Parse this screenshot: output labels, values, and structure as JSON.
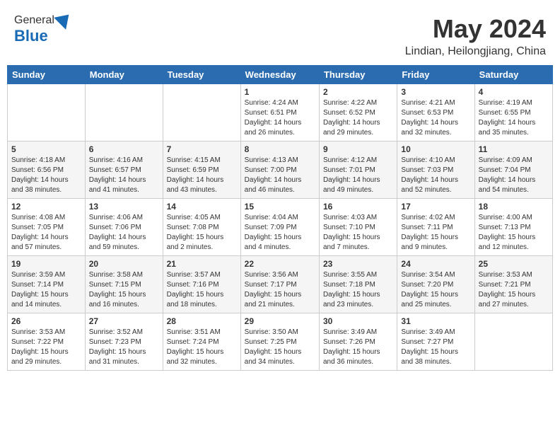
{
  "header": {
    "logo_general": "General",
    "logo_blue": "Blue",
    "month": "May 2024",
    "location": "Lindian, Heilongjiang, China"
  },
  "days_of_week": [
    "Sunday",
    "Monday",
    "Tuesday",
    "Wednesday",
    "Thursday",
    "Friday",
    "Saturday"
  ],
  "weeks": [
    [
      {
        "day": "",
        "info": ""
      },
      {
        "day": "",
        "info": ""
      },
      {
        "day": "",
        "info": ""
      },
      {
        "day": "1",
        "info": "Sunrise: 4:24 AM\nSunset: 6:51 PM\nDaylight: 14 hours\nand 26 minutes."
      },
      {
        "day": "2",
        "info": "Sunrise: 4:22 AM\nSunset: 6:52 PM\nDaylight: 14 hours\nand 29 minutes."
      },
      {
        "day": "3",
        "info": "Sunrise: 4:21 AM\nSunset: 6:53 PM\nDaylight: 14 hours\nand 32 minutes."
      },
      {
        "day": "4",
        "info": "Sunrise: 4:19 AM\nSunset: 6:55 PM\nDaylight: 14 hours\nand 35 minutes."
      }
    ],
    [
      {
        "day": "5",
        "info": "Sunrise: 4:18 AM\nSunset: 6:56 PM\nDaylight: 14 hours\nand 38 minutes."
      },
      {
        "day": "6",
        "info": "Sunrise: 4:16 AM\nSunset: 6:57 PM\nDaylight: 14 hours\nand 41 minutes."
      },
      {
        "day": "7",
        "info": "Sunrise: 4:15 AM\nSunset: 6:59 PM\nDaylight: 14 hours\nand 43 minutes."
      },
      {
        "day": "8",
        "info": "Sunrise: 4:13 AM\nSunset: 7:00 PM\nDaylight: 14 hours\nand 46 minutes."
      },
      {
        "day": "9",
        "info": "Sunrise: 4:12 AM\nSunset: 7:01 PM\nDaylight: 14 hours\nand 49 minutes."
      },
      {
        "day": "10",
        "info": "Sunrise: 4:10 AM\nSunset: 7:03 PM\nDaylight: 14 hours\nand 52 minutes."
      },
      {
        "day": "11",
        "info": "Sunrise: 4:09 AM\nSunset: 7:04 PM\nDaylight: 14 hours\nand 54 minutes."
      }
    ],
    [
      {
        "day": "12",
        "info": "Sunrise: 4:08 AM\nSunset: 7:05 PM\nDaylight: 14 hours\nand 57 minutes."
      },
      {
        "day": "13",
        "info": "Sunrise: 4:06 AM\nSunset: 7:06 PM\nDaylight: 14 hours\nand 59 minutes."
      },
      {
        "day": "14",
        "info": "Sunrise: 4:05 AM\nSunset: 7:08 PM\nDaylight: 15 hours\nand 2 minutes."
      },
      {
        "day": "15",
        "info": "Sunrise: 4:04 AM\nSunset: 7:09 PM\nDaylight: 15 hours\nand 4 minutes."
      },
      {
        "day": "16",
        "info": "Sunrise: 4:03 AM\nSunset: 7:10 PM\nDaylight: 15 hours\nand 7 minutes."
      },
      {
        "day": "17",
        "info": "Sunrise: 4:02 AM\nSunset: 7:11 PM\nDaylight: 15 hours\nand 9 minutes."
      },
      {
        "day": "18",
        "info": "Sunrise: 4:00 AM\nSunset: 7:13 PM\nDaylight: 15 hours\nand 12 minutes."
      }
    ],
    [
      {
        "day": "19",
        "info": "Sunrise: 3:59 AM\nSunset: 7:14 PM\nDaylight: 15 hours\nand 14 minutes."
      },
      {
        "day": "20",
        "info": "Sunrise: 3:58 AM\nSunset: 7:15 PM\nDaylight: 15 hours\nand 16 minutes."
      },
      {
        "day": "21",
        "info": "Sunrise: 3:57 AM\nSunset: 7:16 PM\nDaylight: 15 hours\nand 18 minutes."
      },
      {
        "day": "22",
        "info": "Sunrise: 3:56 AM\nSunset: 7:17 PM\nDaylight: 15 hours\nand 21 minutes."
      },
      {
        "day": "23",
        "info": "Sunrise: 3:55 AM\nSunset: 7:18 PM\nDaylight: 15 hours\nand 23 minutes."
      },
      {
        "day": "24",
        "info": "Sunrise: 3:54 AM\nSunset: 7:20 PM\nDaylight: 15 hours\nand 25 minutes."
      },
      {
        "day": "25",
        "info": "Sunrise: 3:53 AM\nSunset: 7:21 PM\nDaylight: 15 hours\nand 27 minutes."
      }
    ],
    [
      {
        "day": "26",
        "info": "Sunrise: 3:53 AM\nSunset: 7:22 PM\nDaylight: 15 hours\nand 29 minutes."
      },
      {
        "day": "27",
        "info": "Sunrise: 3:52 AM\nSunset: 7:23 PM\nDaylight: 15 hours\nand 31 minutes."
      },
      {
        "day": "28",
        "info": "Sunrise: 3:51 AM\nSunset: 7:24 PM\nDaylight: 15 hours\nand 32 minutes."
      },
      {
        "day": "29",
        "info": "Sunrise: 3:50 AM\nSunset: 7:25 PM\nDaylight: 15 hours\nand 34 minutes."
      },
      {
        "day": "30",
        "info": "Sunrise: 3:49 AM\nSunset: 7:26 PM\nDaylight: 15 hours\nand 36 minutes."
      },
      {
        "day": "31",
        "info": "Sunrise: 3:49 AM\nSunset: 7:27 PM\nDaylight: 15 hours\nand 38 minutes."
      },
      {
        "day": "",
        "info": ""
      }
    ]
  ]
}
